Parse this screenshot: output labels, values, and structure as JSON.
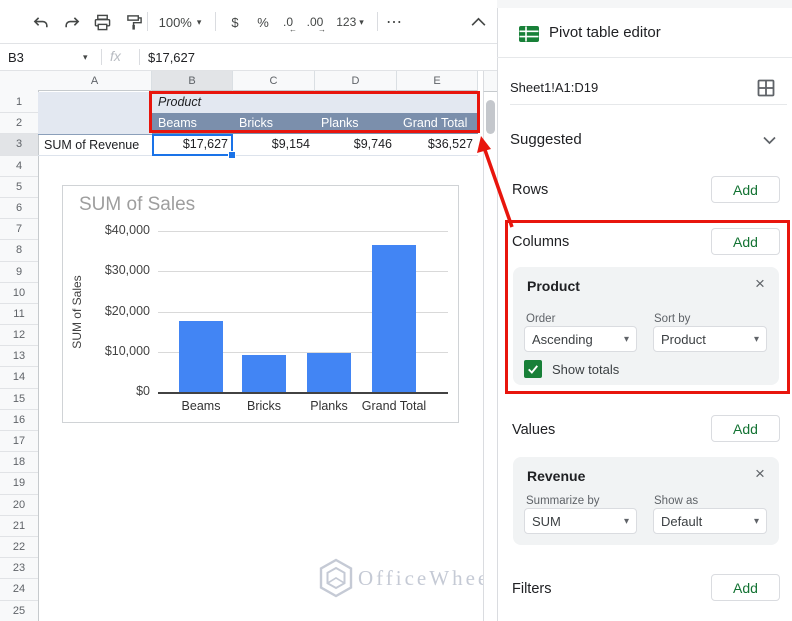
{
  "toolbar": {
    "zoom_value": "100%",
    "format_currency": "$",
    "format_percent": "%",
    "decrease_decimal": ".0",
    "increase_decimal": ".00",
    "more_formats": "123",
    "more_label": "⋯",
    "caret": "▾"
  },
  "formula_bar": {
    "cell_ref": "B3",
    "fx_label": "fx",
    "value": "$17,627"
  },
  "spreadsheet": {
    "selected_cell": "B3",
    "columns": [
      "A",
      "B",
      "C",
      "D",
      "E"
    ],
    "row_numbers": [
      "1",
      "2",
      "3",
      "4",
      "5",
      "6",
      "7",
      "8",
      "9",
      "10",
      "11",
      "12",
      "13",
      "14",
      "15",
      "16",
      "17",
      "18",
      "19",
      "20",
      "21",
      "22",
      "23",
      "24",
      "25"
    ],
    "pivot": {
      "group_label": "Product",
      "column_headers": [
        "Beams",
        "Bricks",
        "Planks",
        "Grand Total"
      ],
      "row_label": "SUM of Revenue",
      "values": [
        "$17,627",
        "$9,154",
        "$9,746",
        "$36,527"
      ]
    }
  },
  "chart_data": {
    "type": "bar",
    "title": "SUM of Sales",
    "xlabel": "",
    "ylabel": "SUM of Sales",
    "categories": [
      "Beams",
      "Bricks",
      "Planks",
      "Grand Total"
    ],
    "values": [
      17627,
      9154,
      9746,
      36527
    ],
    "ylim": [
      0,
      40000
    ],
    "ytick_labels": [
      "$0",
      "$10,000",
      "$20,000",
      "$30,000",
      "$40,000"
    ],
    "ytick_values": [
      0,
      10000,
      20000,
      30000,
      40000
    ],
    "bar_color": "#4285f4",
    "grid": true,
    "legend": "none"
  },
  "panel": {
    "title": "Pivot table editor",
    "range": "Sheet1!A1:D19",
    "suggested_label": "Suggested",
    "rows_label": "Rows",
    "columns_label": "Columns",
    "values_label": "Values",
    "filters_label": "Filters",
    "add_label": "Add",
    "columns_card": {
      "title": "Product",
      "close": "×",
      "order_label": "Order",
      "order_value": "Ascending",
      "sort_label": "Sort by",
      "sort_value": "Product",
      "show_totals_label": "Show totals",
      "show_totals_checked": true
    },
    "values_card": {
      "title": "Revenue",
      "close": "×",
      "summarize_label": "Summarize by",
      "summarize_value": "SUM",
      "show_as_label": "Show as",
      "show_as_value": "Default"
    }
  },
  "watermark": {
    "text": "OfficeWheel"
  },
  "colors": {
    "selection_blue": "#1a73e8",
    "bar_blue": "#4285f4",
    "pivot_header_dark": "#7b8fac",
    "pivot_header_light": "#e3e8f1",
    "annotation_red": "#e8150d",
    "brand_green": "#188038",
    "add_green": "#137333"
  }
}
